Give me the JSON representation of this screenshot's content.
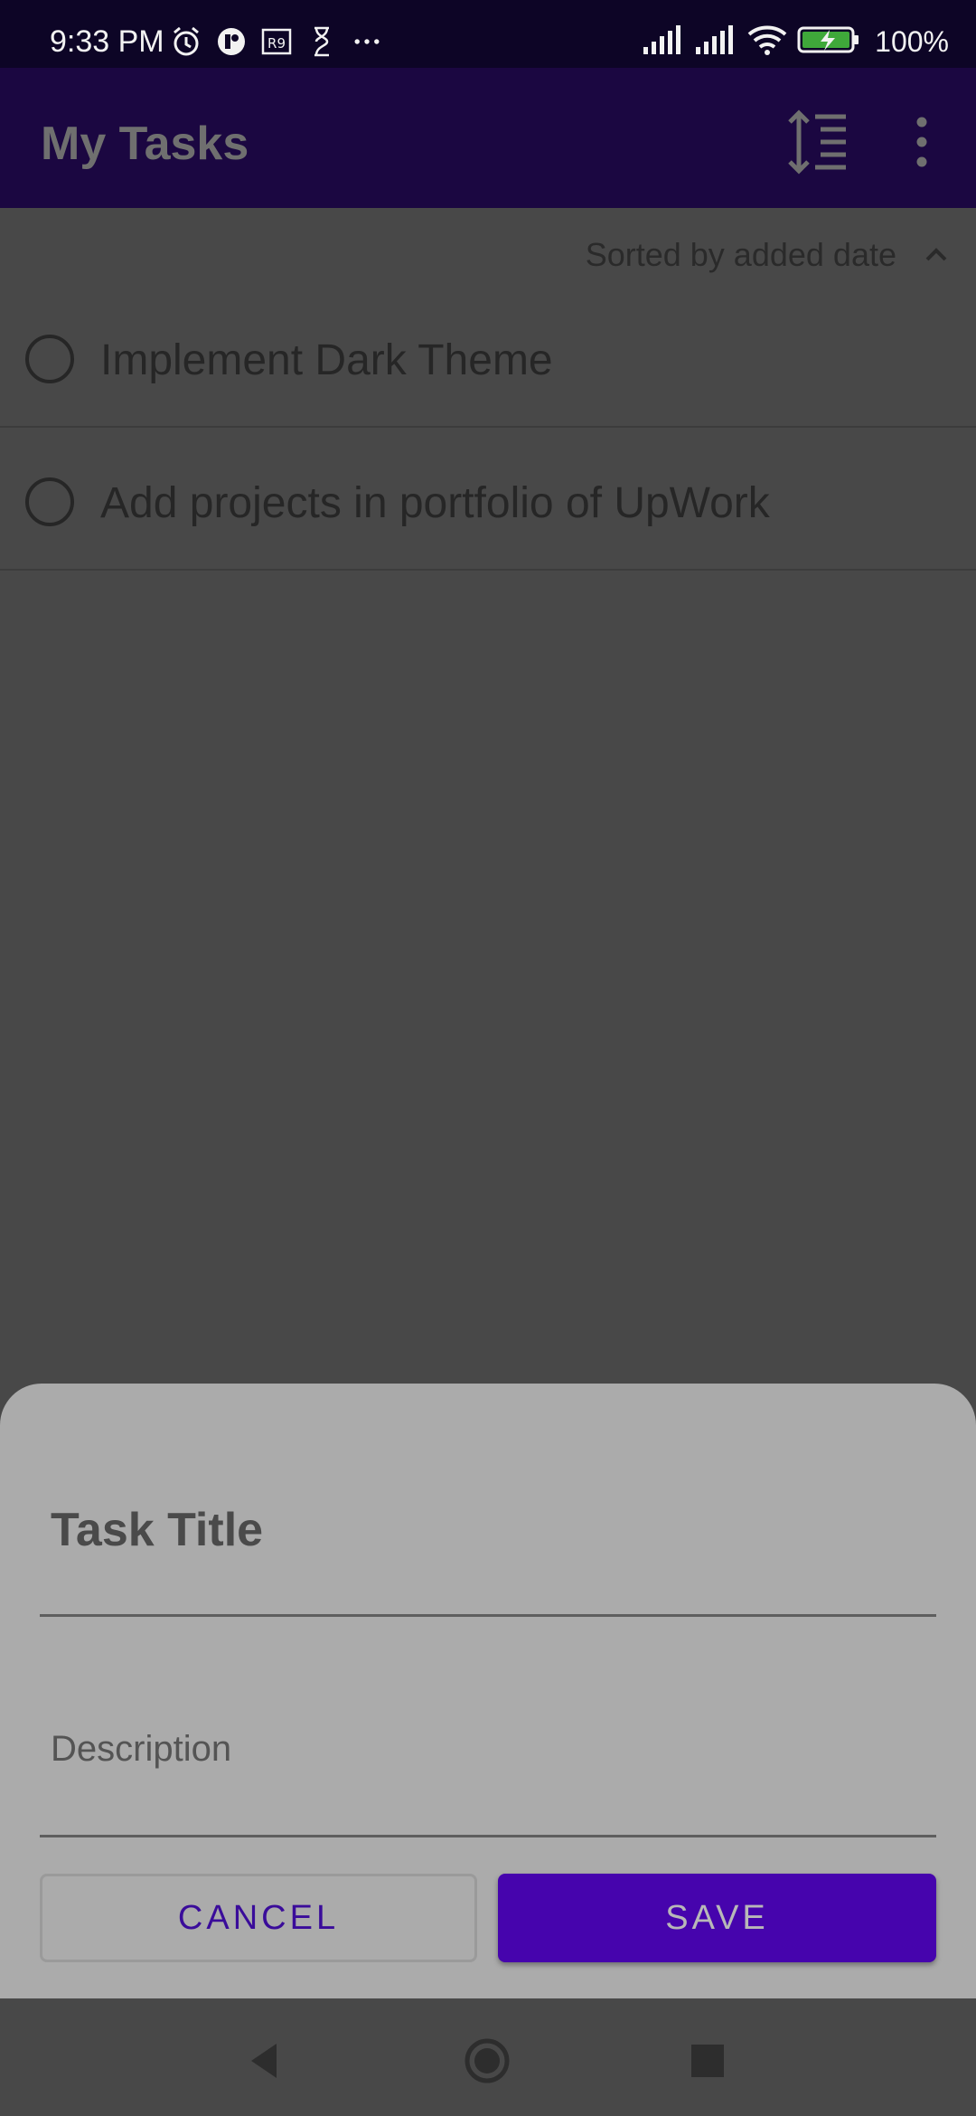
{
  "status_bar": {
    "time": "9:33 PM",
    "battery": "100%",
    "left_icons": [
      "alarm-icon",
      "app-notification-icon",
      "currency-icon",
      "hourglass-icon",
      "more-notifications-icon"
    ],
    "right_icons": [
      "signal-icon",
      "signal-icon",
      "wifi-icon",
      "battery-charging-icon"
    ]
  },
  "app_bar": {
    "title": "My Tasks",
    "sort_icon": "sort-icon",
    "menu_icon": "more-vert-icon"
  },
  "sort": {
    "label": "Sorted by added date",
    "direction_icon": "chevron-up-icon"
  },
  "tasks": [
    {
      "title": "Implement Dark Theme",
      "completed": false
    },
    {
      "title": "Add projects in portfolio of UpWork",
      "completed": false
    }
  ],
  "sheet": {
    "title_placeholder": "Task Title",
    "description_placeholder": "Description",
    "cancel_label": "CANCEL",
    "save_label": "SAVE"
  },
  "colors": {
    "primary": "#4604ad",
    "app_bar": "#1b0741",
    "scrim": "#484848"
  },
  "nav_bar": {
    "icons": [
      "back-icon",
      "home-icon",
      "recents-icon"
    ]
  }
}
